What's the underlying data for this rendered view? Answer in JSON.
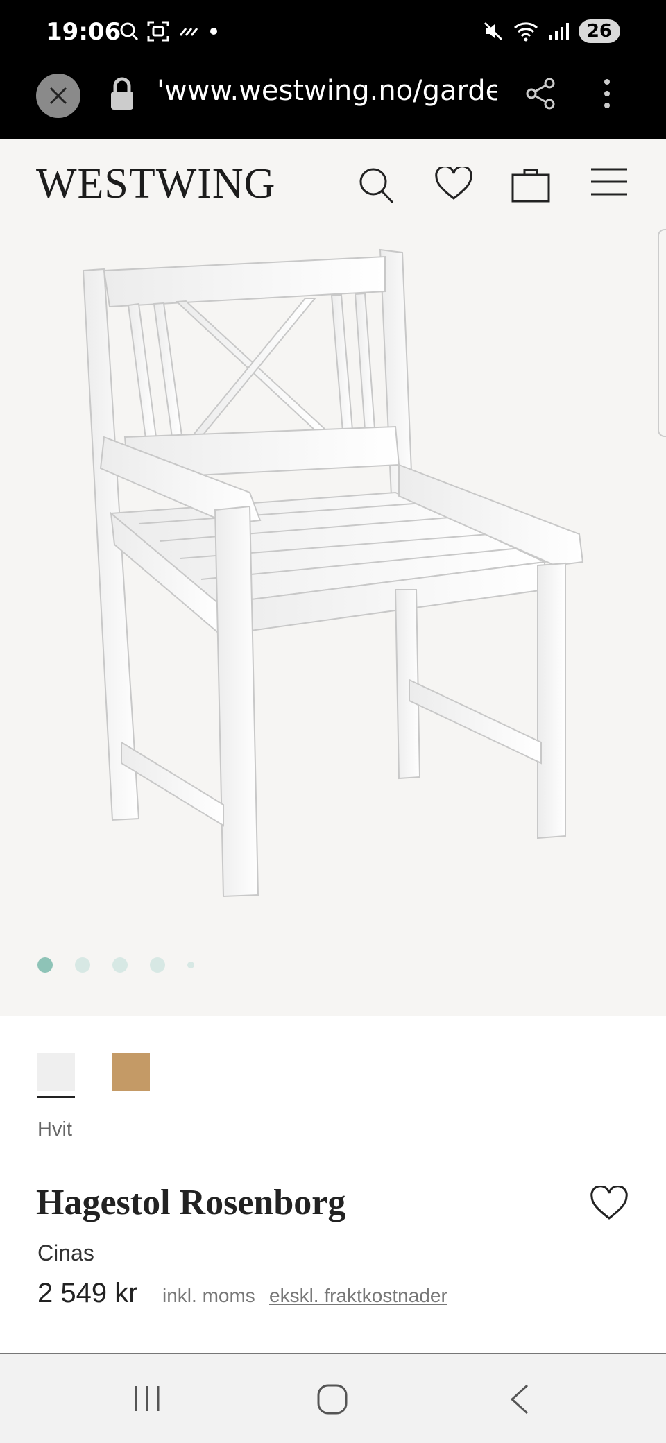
{
  "status_bar": {
    "time": "19:06",
    "battery": "26"
  },
  "browser": {
    "url": "'www.westwing.no/garden"
  },
  "header": {
    "logo": "WESTWING"
  },
  "gallery": {
    "image_count": 5,
    "active_index": 0
  },
  "product": {
    "selected_color": "Hvit",
    "colors": [
      "#efefef",
      "#c49a66"
    ],
    "title": "Hagestol Rosenborg",
    "brand": "Cinas",
    "price": "2 549 kr",
    "vat_note": "inkl. moms",
    "shipping_link": "ekskl. fraktkostnader"
  },
  "colors": {
    "accent_dot": "#8ec3b7",
    "page_bg": "#f6f5f3"
  }
}
